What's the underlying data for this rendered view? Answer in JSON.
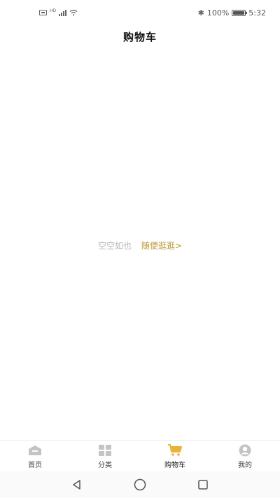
{
  "status_bar": {
    "battery_percent": "100%",
    "time": "5:32",
    "hd_label": "HD",
    "battery_level": 1.0
  },
  "header": {
    "title": "购物车"
  },
  "empty_state": {
    "message": "空空如也",
    "link_label": "随便逛逛>"
  },
  "tabbar": {
    "active": "cart",
    "items": [
      {
        "key": "home",
        "label": "首页",
        "icon": "home-icon"
      },
      {
        "key": "category",
        "label": "分类",
        "icon": "grid-icon"
      },
      {
        "key": "cart",
        "label": "购物车",
        "icon": "cart-icon"
      },
      {
        "key": "me",
        "label": "我的",
        "icon": "user-icon"
      }
    ]
  },
  "colors": {
    "accent": "#e8b33a",
    "link": "#b8952f",
    "icon_inactive": "#c4c4c4"
  }
}
